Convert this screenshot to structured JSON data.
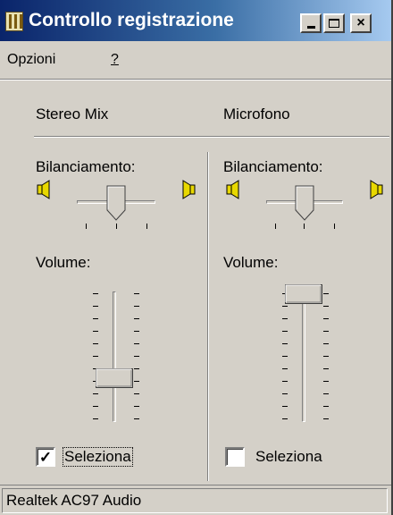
{
  "window": {
    "title": "Controllo registrazione",
    "title_buttons": {
      "minimize": "_",
      "maximize": "□",
      "close": "×"
    }
  },
  "menu": {
    "items": [
      {
        "label": "Opzioni",
        "accel": "p"
      },
      {
        "label": "?",
        "accel": "?"
      }
    ]
  },
  "channels": [
    {
      "title": "Stereo Mix",
      "balance_label": "Bilanciamento:",
      "balance": 0.5,
      "volume_label": "Volume:",
      "volume": 0.28,
      "select_label": "Seleziona",
      "selected": true
    },
    {
      "title": "Microfono",
      "balance_label": "Bilanciamento:",
      "balance": 0.5,
      "volume_label": "Volume:",
      "volume": 1.0,
      "select_label": "Seleziona",
      "selected": false
    }
  ],
  "status": {
    "text": "Realtek AC97 Audio"
  },
  "icons": {
    "balance_left": "speaker-left-icon",
    "balance_right": "speaker-right-icon",
    "app": "mixer-icon"
  },
  "colors": {
    "titlebar_start": "#0a246a",
    "titlebar_end": "#a6caf0",
    "face": "#d4d0c8",
    "speaker": "#e8d800"
  }
}
